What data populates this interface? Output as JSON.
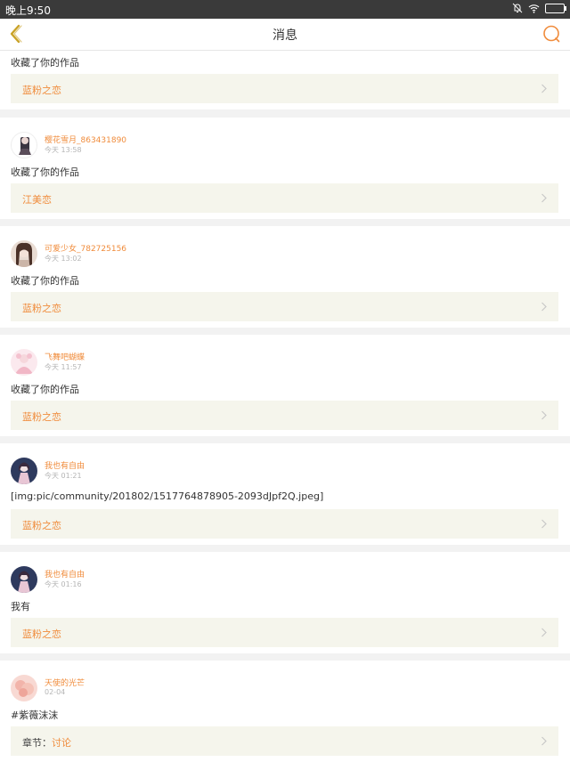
{
  "status": {
    "time": "晚上9:50"
  },
  "header": {
    "title": "消息"
  },
  "colors": {
    "accent": "#f08c3c",
    "work_bg": "#f5f5ec"
  },
  "items": [
    {
      "action": "收藏了你的作品",
      "work": "蓝粉之恋"
    },
    {
      "user": "樱花雪月_863431890",
      "time": "今天 13:58",
      "action": "收藏了你的作品",
      "work": "江美恋"
    },
    {
      "user": "可爱少女_782725156",
      "time": "今天 13:02",
      "action": "收藏了你的作品",
      "work": "蓝粉之恋"
    },
    {
      "user": "飞舞吧蝴蝶",
      "time": "今天 11:57",
      "action": "收藏了你的作品",
      "work": "蓝粉之恋"
    },
    {
      "user": "我也有自由",
      "time": "今天 01:21",
      "action": "[img:pic/community/201802/1517764878905-2093dJpf2Q.jpeg]",
      "work": "蓝粉之恋"
    },
    {
      "user": "我也有自由",
      "time": "今天 01:16",
      "action": "我有",
      "work": "蓝粉之恋"
    },
    {
      "user": "天使的光芒",
      "time": "02-04",
      "action": "#紫薇沫沫",
      "work_prefix": "章节：",
      "work": "讨论"
    }
  ]
}
